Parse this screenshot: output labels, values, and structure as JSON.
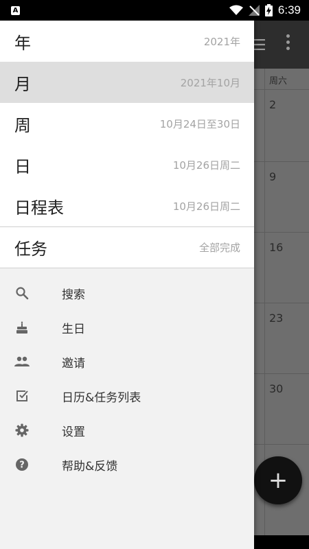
{
  "status_bar": {
    "time": "6:39",
    "notification_icon": "A"
  },
  "calendar": {
    "weekday_header": "周六",
    "dates": [
      "2",
      "9",
      "16",
      "23",
      "30"
    ]
  },
  "fab": {
    "label": "+"
  },
  "drawer": {
    "views": [
      {
        "label": "年",
        "date": "2021年"
      },
      {
        "label": "月",
        "date": "2021年10月"
      },
      {
        "label": "周",
        "date": "10月24日至30日"
      },
      {
        "label": "日",
        "date": "10月26日周二"
      },
      {
        "label": "日程表",
        "date": "10月26日周二"
      }
    ],
    "tasks": {
      "label": "任务",
      "status": "全部完成"
    },
    "menu": [
      {
        "label": "搜索",
        "icon": "search-icon"
      },
      {
        "label": "生日",
        "icon": "cake-icon"
      },
      {
        "label": "邀请",
        "icon": "people-icon"
      },
      {
        "label": "日历&任务列表",
        "icon": "checklist-icon"
      },
      {
        "label": "设置",
        "icon": "gear-icon"
      },
      {
        "label": "帮助&反馈",
        "icon": "help-icon"
      }
    ]
  }
}
